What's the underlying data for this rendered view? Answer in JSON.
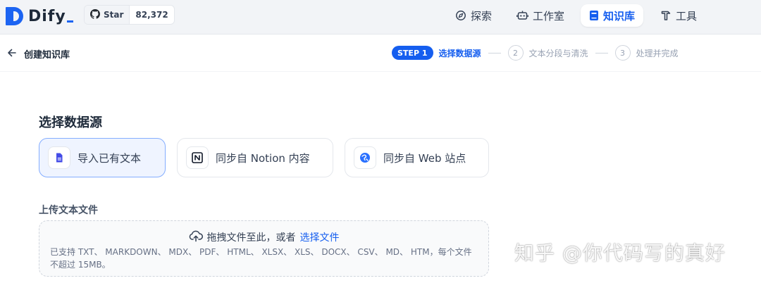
{
  "app": {
    "name": "Dify",
    "github": {
      "label": "Star",
      "count": "82,372",
      "icon": "github-icon"
    }
  },
  "nav": {
    "items": [
      {
        "label": "探索",
        "icon": "compass-icon",
        "active": false
      },
      {
        "label": "工作室",
        "icon": "robot-icon",
        "active": false
      },
      {
        "label": "知识库",
        "icon": "book-icon",
        "active": true
      },
      {
        "label": "工具",
        "icon": "hammer-icon",
        "active": false
      }
    ]
  },
  "header": {
    "title": "创建知识库",
    "steps": {
      "active_badge": "STEP 1",
      "active_label": "选择数据源",
      "step2_num": "2",
      "step2_label": "文本分段与清洗",
      "step3_num": "3",
      "step3_label": "处理并完成"
    }
  },
  "main": {
    "section_title": "选择数据源",
    "sources": [
      {
        "label": "导入已有文本",
        "icon": "file-text-icon",
        "selected": true
      },
      {
        "label": "同步自 Notion 内容",
        "icon": "notion-icon",
        "selected": false
      },
      {
        "label": "同步自 Web 站点",
        "icon": "web-icon",
        "selected": false
      }
    ],
    "upload": {
      "title": "上传文本文件",
      "prompt": "拖拽文件至此，或者",
      "link": "选择文件",
      "hint": "已支持 TXT、 MARKDOWN、 MDX、 PDF、 HTML、 XLSX、 XLS、 DOCX、 CSV、 MD、 HTM，每个文件不超过 15MB。"
    }
  },
  "watermark": "知乎 @你代码写的真好",
  "colors": {
    "accent": "#155eef",
    "topbar_bg": "#f2f4f7",
    "selected_bg": "#eff4ff"
  }
}
